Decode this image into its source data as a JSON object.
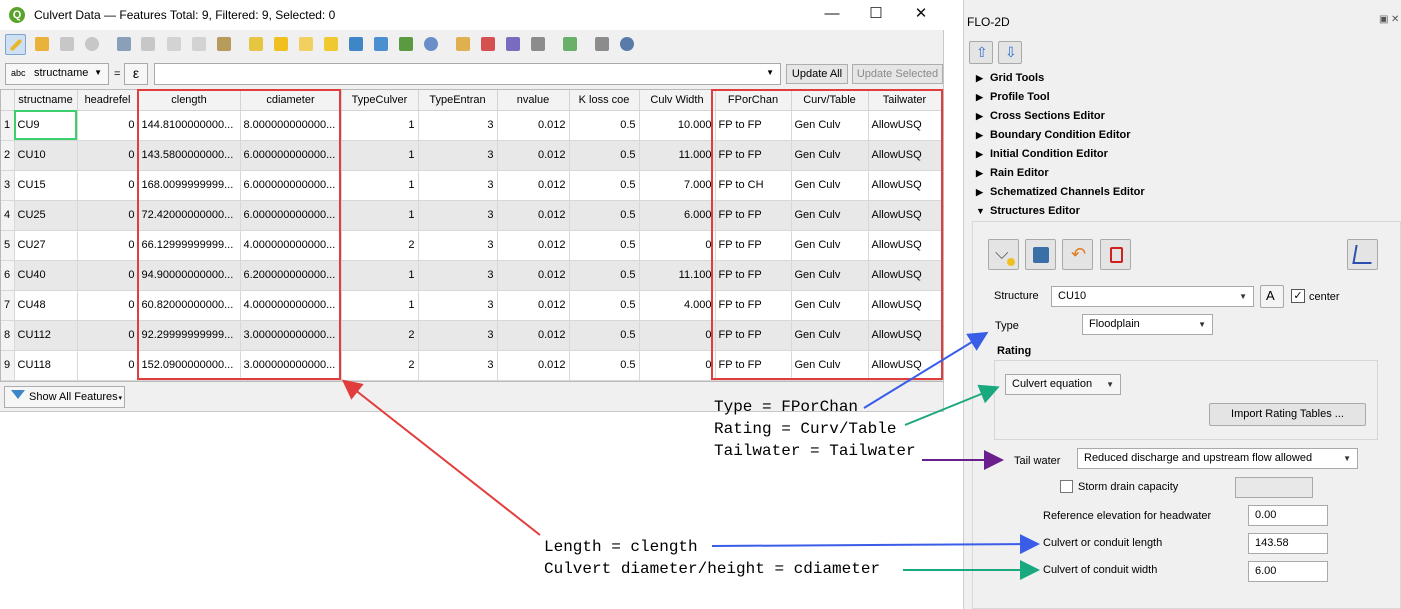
{
  "window": {
    "title": "Culvert Data — Features Total: 9, Filtered: 9, Selected: 0",
    "min": "—",
    "max": "☐",
    "close": "✕"
  },
  "filter": {
    "field": "structname",
    "field_prefix": "abc",
    "eq": "=",
    "expr": "ε",
    "update_all": "Update All",
    "update_selected": "Update Selected"
  },
  "table": {
    "headers": [
      "structname",
      "headrefel",
      "clength",
      "cdiameter",
      "TypeCulver",
      "TypeEntran",
      "nvalue",
      "K loss coe",
      "Culv Width",
      "FPorChan",
      "Curv/Table",
      "Tailwater"
    ],
    "rows": [
      [
        "1",
        "CU9",
        "0",
        "144.8100000000...",
        "8.000000000000...",
        "1",
        "3",
        "0.012",
        "0.5",
        "10.000",
        "FP to FP",
        "Gen Culv",
        "AllowUSQ"
      ],
      [
        "2",
        "CU10",
        "0",
        "143.5800000000...",
        "6.000000000000...",
        "1",
        "3",
        "0.012",
        "0.5",
        "11.000",
        "FP to FP",
        "Gen Culv",
        "AllowUSQ"
      ],
      [
        "3",
        "CU15",
        "0",
        "168.0099999999...",
        "6.000000000000...",
        "1",
        "3",
        "0.012",
        "0.5",
        "7.000",
        "FP to CH",
        "Gen Culv",
        "AllowUSQ"
      ],
      [
        "4",
        "CU25",
        "0",
        "72.42000000000...",
        "6.000000000000...",
        "1",
        "3",
        "0.012",
        "0.5",
        "6.000",
        "FP to FP",
        "Gen Culv",
        "AllowUSQ"
      ],
      [
        "5",
        "CU27",
        "0",
        "66.12999999999...",
        "4.000000000000...",
        "2",
        "3",
        "0.012",
        "0.5",
        "0",
        "FP to FP",
        "Gen Culv",
        "AllowUSQ"
      ],
      [
        "6",
        "CU40",
        "0",
        "94.90000000000...",
        "6.200000000000...",
        "1",
        "3",
        "0.012",
        "0.5",
        "11.100",
        "FP to FP",
        "Gen Culv",
        "AllowUSQ"
      ],
      [
        "7",
        "CU48",
        "0",
        "60.82000000000...",
        "4.000000000000...",
        "1",
        "3",
        "0.012",
        "0.5",
        "4.000",
        "FP to FP",
        "Gen Culv",
        "AllowUSQ"
      ],
      [
        "8",
        "CU112",
        "0",
        "92.29999999999...",
        "3.000000000000...",
        "2",
        "3",
        "0.012",
        "0.5",
        "0",
        "FP to FP",
        "Gen Culv",
        "AllowUSQ"
      ],
      [
        "9",
        "CU118",
        "0",
        "152.0900000000...",
        "3.000000000000...",
        "2",
        "3",
        "0.012",
        "0.5",
        "0",
        "FP to FP",
        "Gen Culv",
        "AllowUSQ"
      ]
    ]
  },
  "show_all": "Show All Features",
  "panel": {
    "title": "FLO-2D",
    "tree": [
      "Grid Tools",
      "Profile Tool",
      "Cross Sections Editor",
      "Boundary Condition Editor",
      "Initial Condition Editor",
      "Rain Editor",
      "Schematized Channels Editor",
      "Structures Editor"
    ],
    "structure_label": "Structure",
    "structure_value": "CU10",
    "center_label": "center",
    "type_label": "Type",
    "type_value": "Floodplain",
    "rating_label": "Rating",
    "rating_value": "Culvert equation",
    "import_btn": "Import Rating Tables ...",
    "tailwater_label": "Tail water",
    "tailwater_value": "Reduced discharge and upstream flow allowed",
    "storm_label": "Storm drain capacity",
    "ref_label": "Reference elevation for headwater",
    "ref_value": "0.00",
    "len_label": "Culvert or conduit length",
    "len_value": "143.58",
    "width_label": "Culvert of conduit width",
    "width_value": "6.00"
  },
  "annotations": {
    "a1": "Type = FPorChan",
    "a2": "Rating = Curv/Table",
    "a3": "Tailwater = Tailwater",
    "a4": "Length = clength",
    "a5": "Culvert diameter/height = cdiameter"
  },
  "colors": {
    "red": "#e23d3d",
    "blue": "#3a5de8",
    "green": "#1aa87e",
    "purple": "#6a1f8c",
    "cell_focus": "#3ccf6e"
  }
}
